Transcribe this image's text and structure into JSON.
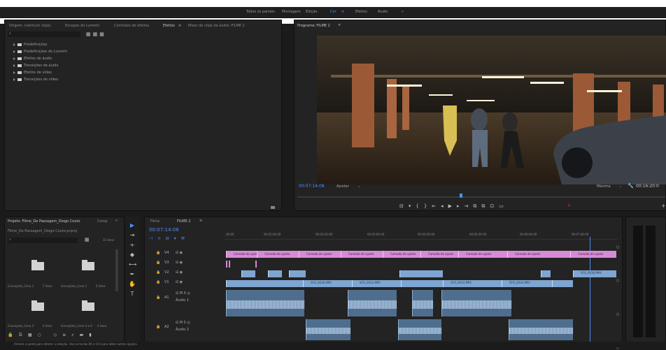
{
  "workspaces": {
    "items": [
      "Todos os painéis",
      "Montagem",
      "Edição",
      "Cor",
      "Efeitos",
      "Áudio",
      "»"
    ],
    "active_index": 3,
    "menu_glyph": "≡"
  },
  "effects_panel": {
    "tabs": [
      "Origem: (nenhum clipe)",
      "Escopos do Lumetri",
      "Controles de efeitos",
      "Efeitos",
      "Mixer de clipe de áudio: FILME 2"
    ],
    "active_tab_index": 3,
    "search_placeholder": "",
    "tree": [
      "Predefinições",
      "Predefinições do Lumetri",
      "Efeitos de áudio",
      "Transições de áudio",
      "Efeitos de vídeo",
      "Transições de vídeo"
    ]
  },
  "program_monitor": {
    "title": "Programa: FILME 2",
    "timecode_left": "00:07:14:08",
    "fit": "Ajustar",
    "quality": "Máxima",
    "timecode_right": "00:16:20:0"
  },
  "project_panel": {
    "title": "Projeto: Filme_De Passagem_Diogo Couto",
    "tab2": "Comp",
    "file": "Filme_De Passagem_Diogo Couto.prproj",
    "item_count": "15 itens",
    "bins": [
      {
        "label": "Gravações_Cena 1",
        "count": "7 itens"
      },
      {
        "label": "Gravações_Cena 1",
        "count": "6 itens"
      },
      {
        "label": "Gravações_Cena 2",
        "count": "4 itens"
      },
      {
        "label": "Gravações_Cena 3 e 4",
        "count": "4 itens"
      }
    ]
  },
  "timeline": {
    "tabs": [
      "Filme",
      "FILME 2"
    ],
    "active_tab_index": 1,
    "timecode": "00:07:14:08",
    "ruler": [
      "00:00",
      "00:01:00:00",
      "00:02:00:00",
      "00:03:00:00",
      "00:04:00:00",
      "00:05:00:00",
      "00:06:00:00",
      "00:07:00:00"
    ],
    "tracks": [
      {
        "id": "V4",
        "pink_clips": [
          "Camada de ajuste",
          "Camada de ajuste",
          "Camada de ajuste",
          "Camada de ajuste",
          "Camada de ajuste",
          "Camada de ajuste",
          "Camada de ajuste",
          "Camada de ajuste",
          "Camada de ajuste"
        ]
      },
      {
        "id": "V3"
      },
      {
        "id": "V2",
        "blue_labels": [
          "SFO_0036.MP4",
          "SFO_0036.MP4",
          "SFO_0014.MP4",
          "SFO_0033.MP4",
          "SFO_0034.MP4"
        ]
      },
      {
        "id": "V1"
      },
      {
        "id": "A1",
        "name": "Áudio 1"
      },
      {
        "id": "A2",
        "name": "Áudio 2"
      }
    ]
  },
  "status_bar": "Arraste o ponto para alterar a seleção. Use as teclas Alt e Ctrl para obter outras opções.",
  "colors": {
    "accent": "#4a8fff",
    "adjustment_clip": "#d78bd6",
    "video_clip": "#7fa5d1"
  }
}
